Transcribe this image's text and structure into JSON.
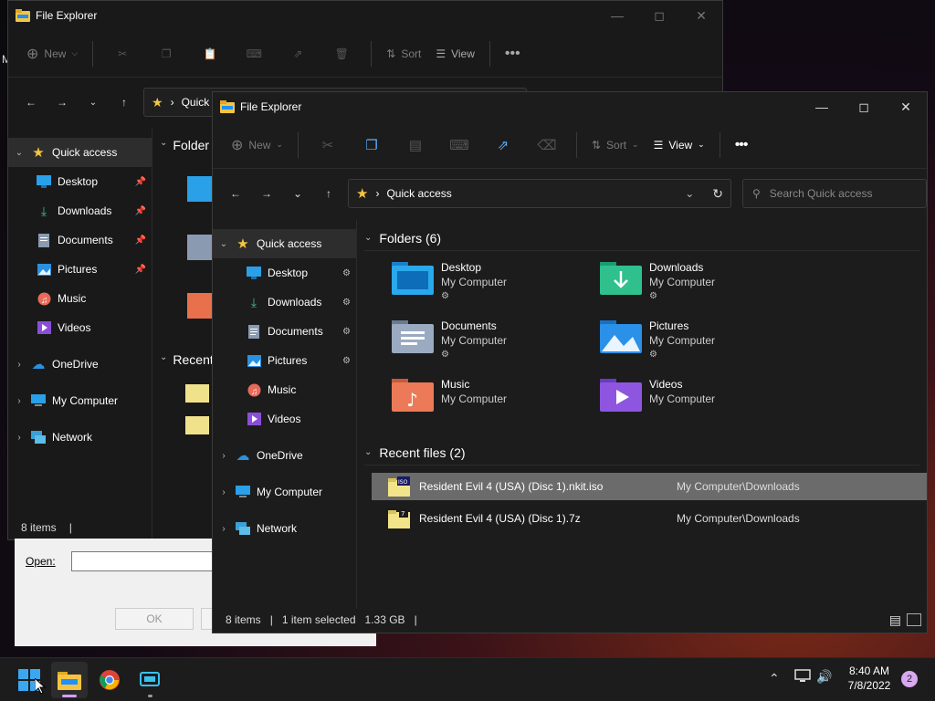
{
  "stray_char": "M",
  "back_window": {
    "title": "File Explorer",
    "toolbar": {
      "new": "New",
      "sort": "Sort",
      "view": "View"
    },
    "address": "Quick a",
    "sidebar": [
      {
        "label": "Quick access",
        "icon": "star-icon"
      },
      {
        "label": "Desktop",
        "icon": "desktop-icon"
      },
      {
        "label": "Downloads",
        "icon": "download-icon"
      },
      {
        "label": "Documents",
        "icon": "document-icon"
      },
      {
        "label": "Pictures",
        "icon": "pictures-icon"
      },
      {
        "label": "Music",
        "icon": "music-icon"
      },
      {
        "label": "Videos",
        "icon": "videos-icon"
      },
      {
        "label": "OneDrive",
        "icon": "cloud-icon"
      },
      {
        "label": "My Computer",
        "icon": "computer-icon"
      },
      {
        "label": "Network",
        "icon": "network-icon"
      }
    ],
    "folders_header": "Folder",
    "recent_header": "Recent",
    "status": "8 items"
  },
  "dialog": {
    "open_label": "Open:",
    "ok_label": "OK"
  },
  "front_window": {
    "title": "File Explorer",
    "toolbar": {
      "new": "New",
      "sort": "Sort",
      "view": "View"
    },
    "breadcrumb": "Quick access",
    "search_placeholder": "Search Quick access",
    "sidebar": [
      {
        "label": "Quick access",
        "icon": "star-icon"
      },
      {
        "label": "Desktop",
        "icon": "desktop-icon"
      },
      {
        "label": "Downloads",
        "icon": "download-icon"
      },
      {
        "label": "Documents",
        "icon": "document-icon"
      },
      {
        "label": "Pictures",
        "icon": "pictures-icon"
      },
      {
        "label": "Music",
        "icon": "music-icon"
      },
      {
        "label": "Videos",
        "icon": "videos-icon"
      },
      {
        "label": "OneDrive",
        "icon": "cloud-icon"
      },
      {
        "label": "My Computer",
        "icon": "computer-icon"
      },
      {
        "label": "Network",
        "icon": "network-icon"
      }
    ],
    "folders_header": "Folders (6)",
    "folders": [
      {
        "name": "Desktop",
        "location": "My Computer",
        "pinned": true
      },
      {
        "name": "Downloads",
        "location": "My Computer",
        "pinned": true
      },
      {
        "name": "Documents",
        "location": "My Computer",
        "pinned": true
      },
      {
        "name": "Pictures",
        "location": "My Computer",
        "pinned": true
      },
      {
        "name": "Music",
        "location": "My Computer",
        "pinned": false
      },
      {
        "name": "Videos",
        "location": "My Computer",
        "pinned": false
      }
    ],
    "recent_header": "Recent files (2)",
    "recent_files": [
      {
        "name": "Resident Evil 4 (USA) (Disc 1).nkit.iso",
        "location": "My Computer\\Downloads",
        "badge": "ISO"
      },
      {
        "name": "Resident Evil 4 (USA) (Disc 1).7z",
        "location": "My Computer\\Downloads",
        "badge": "7"
      }
    ],
    "status": {
      "items": "8 items",
      "selected": "1 item selected",
      "size": "1.33 GB"
    }
  },
  "taskbar": {
    "time": "8:40 AM",
    "date": "7/8/2022",
    "notification_count": "2"
  },
  "colors": {
    "accent": "#0078d4",
    "folder": "#f5c542",
    "selected_row": "#6b6b6b",
    "sidebar_selected": "#2d2d2d"
  }
}
